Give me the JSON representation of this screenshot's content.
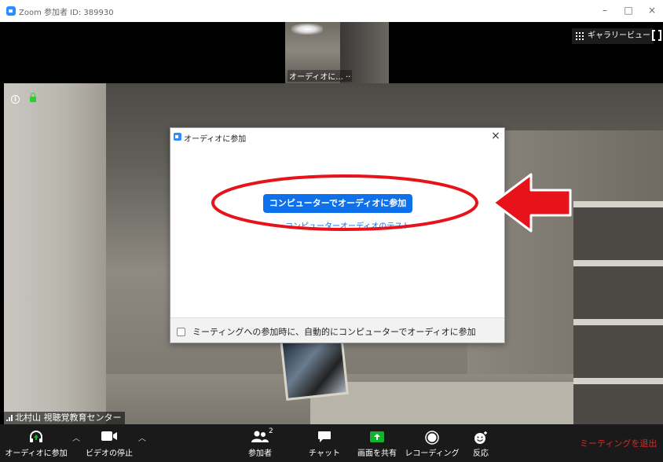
{
  "window": {
    "title": "Zoom 参加者 ID: 389930",
    "minimize": "–",
    "maximize": "□",
    "close": "×"
  },
  "top_strip": {
    "thumbnail_name": "オーディオに... ··",
    "gallery_view_label": "ギャラリービュー"
  },
  "main_video": {
    "participant_name": "北村山 視聴覚教育センター",
    "info_symbol": "i"
  },
  "dialog": {
    "title": "オーディオに参加",
    "close": "×",
    "join_button_label": "コンピューターでオーディオに参加",
    "test_link": "コンピューターオーディオのテスト",
    "auto_join_label": "ミーティングへの参加時に、自動的にコンピューターでオーディオに参加",
    "auto_join_checked": false
  },
  "annotation": {
    "ellipse_color": "#e8121b",
    "arrow_color": "#e8121b"
  },
  "toolbar": {
    "join_audio": "オーディオに参加",
    "stop_video": "ビデオの停止",
    "participants": "参加者",
    "participants_count": "2",
    "chat": "チャット",
    "share_screen": "画面を共有",
    "recording": "レコーディング",
    "reactions": "反応",
    "leave": "ミーティングを退出"
  },
  "colors": {
    "zoom_blue": "#0e71eb",
    "share_green": "#12b22e",
    "leave_red": "#e02828",
    "toolbar_bg": "#1a1a1a"
  }
}
